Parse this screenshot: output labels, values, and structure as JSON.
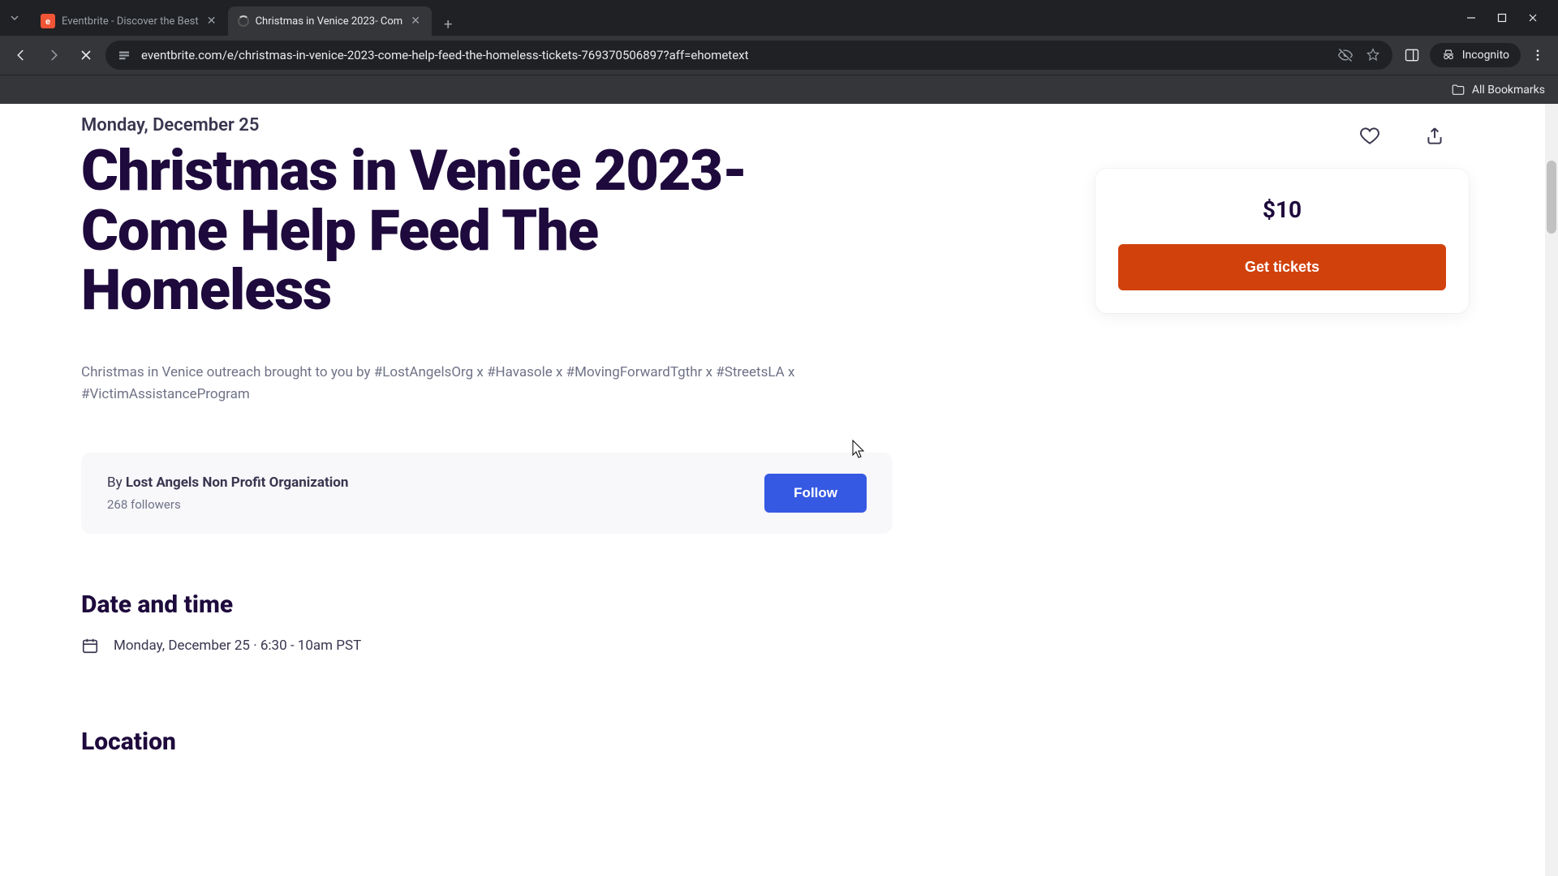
{
  "browser": {
    "tabs": [
      {
        "title": "Eventbrite - Discover the Best",
        "active": false
      },
      {
        "title": "Christmas in Venice 2023- Com",
        "active": true
      }
    ],
    "url": "eventbrite.com/e/christmas-in-venice-2023-come-help-feed-the-homeless-tickets-769370506897?aff=ehometext",
    "incognito_label": "Incognito",
    "all_bookmarks": "All Bookmarks"
  },
  "event": {
    "date_short": "Monday, December 25",
    "title": "Christmas in Venice 2023- Come Help Feed The Homeless",
    "description": "Christmas in Venice outreach brought to you by #LostAngelsOrg x #Havasole x #MovingForwardTgthr x #StreetsLA x #VictimAssistanceProgram",
    "organizer": {
      "by_prefix": "By ",
      "name": "Lost Angels Non Profit Organization",
      "followers": "268 followers",
      "follow_label": "Follow"
    },
    "sections": {
      "datetime_heading": "Date and time",
      "datetime_value": "Monday, December 25 · 6:30 - 10am PST",
      "location_heading": "Location"
    },
    "ticket": {
      "price": "$10",
      "button_label": "Get tickets"
    }
  }
}
